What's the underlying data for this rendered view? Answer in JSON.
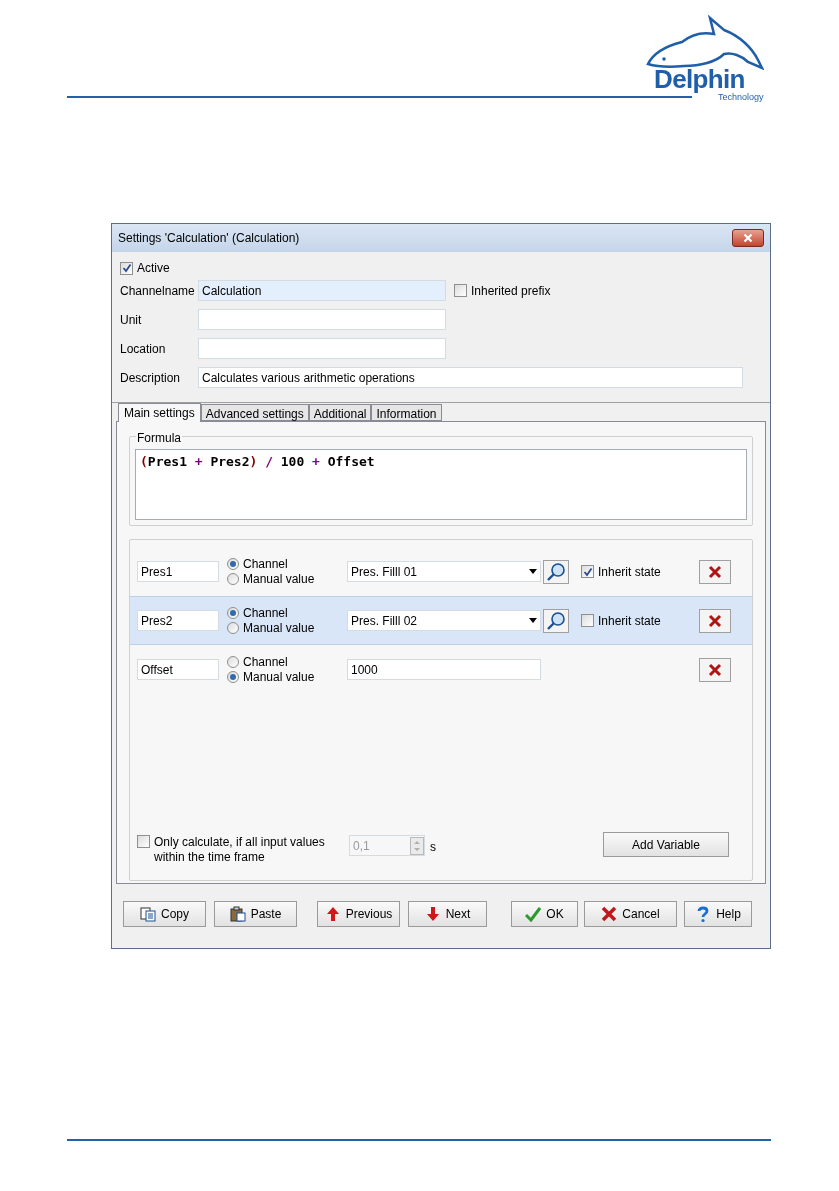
{
  "header": {
    "logo_text": "Delphin",
    "logo_subtext": "Technology"
  },
  "window": {
    "title": "Settings 'Calculation' (Calculation)"
  },
  "active": {
    "label": "Active",
    "checked": true
  },
  "fields": [
    {
      "label": "Channelname",
      "value": "Calculation",
      "highlighted": true
    },
    {
      "label": "Unit",
      "highlighted": false
    },
    {
      "label": "Location",
      "highlighted": false
    },
    {
      "label": "Description",
      "value": "Calculates various arithmetic operations",
      "highlighted": false
    }
  ],
  "inherited_prefix": {
    "label": "Inherited prefix",
    "checked": false
  },
  "tabs": [
    {
      "label": "Main settings",
      "selected": true
    },
    {
      "label": "Advanced settings",
      "selected": false
    },
    {
      "label": "Additional",
      "selected": false
    },
    {
      "label": "Information",
      "selected": false
    }
  ],
  "formula": {
    "label": "Formula",
    "tokens": [
      {
        "text": "(",
        "kind": "paren"
      },
      {
        "text": "Pres1",
        "kind": "operand"
      },
      {
        "text": "+",
        "kind": "operator"
      },
      {
        "text": "Pres2",
        "kind": "operand"
      },
      {
        "text": ")",
        "kind": "paren"
      },
      {
        "text": "/",
        "kind": "operator"
      },
      {
        "text": "100",
        "kind": "operand"
      },
      {
        "text": "+",
        "kind": "operator"
      },
      {
        "text": "Offset",
        "kind": "operand"
      }
    ]
  },
  "variables": [
    {
      "name": "Pres1",
      "kind": "channel",
      "highlighted": false,
      "radios": [
        {
          "label": "Channel",
          "selected": true
        },
        {
          "label": "Manual value",
          "selected": false
        }
      ],
      "value": "Pres. Filll 01",
      "inherit": {
        "label": "Inherit state",
        "checked": true
      }
    },
    {
      "name": "Pres2",
      "kind": "channel",
      "highlighted": true,
      "radios": [
        {
          "label": "Channel",
          "selected": true
        },
        {
          "label": "Manual value",
          "selected": false
        }
      ],
      "value": "Pres. Filll 02",
      "inherit": {
        "label": "Inherit state",
        "checked": false
      }
    },
    {
      "name": "Offset",
      "kind": "manual",
      "highlighted": false,
      "radios": [
        {
          "label": "Channel",
          "selected": false
        },
        {
          "label": "Manual value",
          "selected": true
        }
      ],
      "value": "1000"
    }
  ],
  "only_calculate": {
    "label": "Only calculate, if all input values within the time frame",
    "checked": false
  },
  "time_frame": {
    "value": "0,1",
    "unit": "s",
    "disabled": true
  },
  "add_variable": {
    "label": "Add Variable"
  },
  "buttons": [
    {
      "label": "Copy",
      "kind": "copy"
    },
    {
      "label": "Paste",
      "kind": "paste"
    },
    {
      "label": "Previous",
      "kind": "previous"
    },
    {
      "label": "Next",
      "kind": "next"
    },
    {
      "label": "OK",
      "kind": "ok"
    },
    {
      "label": "Cancel",
      "kind": "cancel"
    },
    {
      "label": "Help",
      "kind": "help"
    }
  ]
}
